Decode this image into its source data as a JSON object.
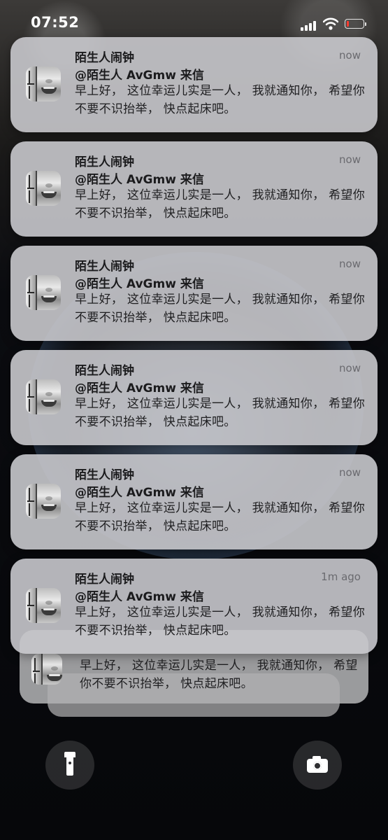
{
  "status_bar": {
    "time": "07:52",
    "battery_level": 0.12,
    "battery_color": "#ff3b30",
    "signal_icon": "cellular-signal-icon",
    "wifi_icon": "wifi-icon",
    "battery_icon": "battery-low-icon"
  },
  "notifications": [
    {
      "app": "陌生人闹钟",
      "time": "now",
      "title": "@陌生人 AvGmw 来信",
      "body": "早上好， 这位幸运儿实是一人， 我就通知你， 希望你不要不识抬举， 快点起床吧。",
      "icon": "face-app-icon"
    },
    {
      "app": "陌生人闹钟",
      "time": "now",
      "title": "@陌生人 AvGmw 来信",
      "body": "早上好， 这位幸运儿实是一人， 我就通知你， 希望你不要不识抬举， 快点起床吧。",
      "icon": "face-app-icon"
    },
    {
      "app": "陌生人闹钟",
      "time": "now",
      "title": "@陌生人 AvGmw 来信",
      "body": "早上好， 这位幸运儿实是一人， 我就通知你， 希望你不要不识抬举， 快点起床吧。",
      "icon": "face-app-icon"
    },
    {
      "app": "陌生人闹钟",
      "time": "now",
      "title": "@陌生人 AvGmw 来信",
      "body": "早上好， 这位幸运儿实是一人， 我就通知你， 希望你不要不识抬举， 快点起床吧。",
      "icon": "face-app-icon"
    },
    {
      "app": "陌生人闹钟",
      "time": "now",
      "title": "@陌生人 AvGmw 来信",
      "body": "早上好， 这位幸运儿实是一人， 我就通知你， 希望你不要不识抬举， 快点起床吧。",
      "icon": "face-app-icon"
    },
    {
      "app": "陌生人闹钟",
      "time": "1m ago",
      "title": "@陌生人 AvGmw 来信",
      "body": "早上好， 这位幸运儿实是一人， 我就通知你， 希望你不要不识抬举， 快点起床吧。",
      "icon": "face-app-icon"
    }
  ],
  "stacked_notification": {
    "body": "早上好， 这位幸运儿实是一人， 我就通知你， 希望你不要不识抬举， 快点起床吧。"
  },
  "bottom_controls": {
    "left_icon": "flashlight-icon",
    "right_icon": "camera-icon"
  }
}
